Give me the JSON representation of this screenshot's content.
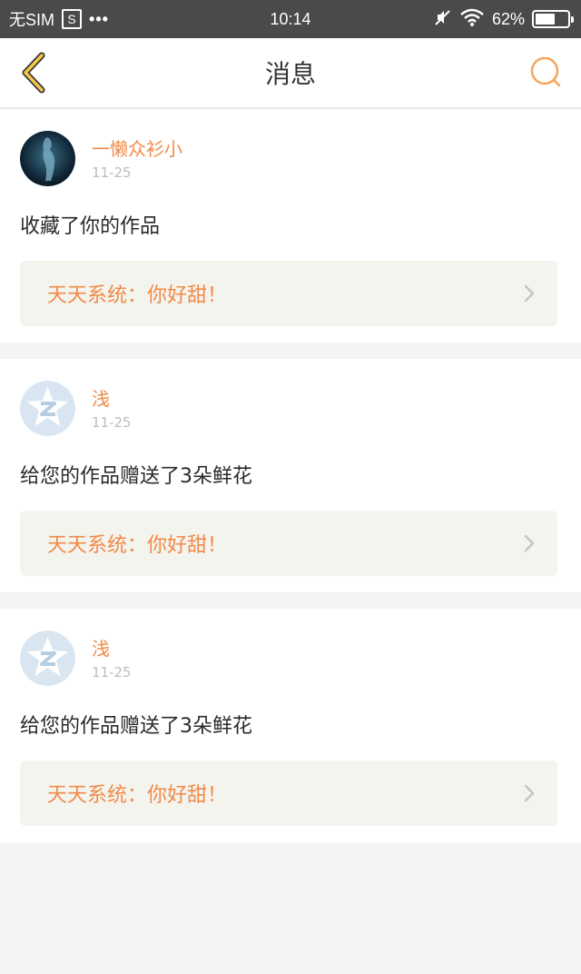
{
  "status_bar": {
    "carrier": "无SIM",
    "sim_icon_letter": "S",
    "dots": "•••",
    "time": "10:14",
    "battery": "62%",
    "battery_level": 0.62
  },
  "nav": {
    "title": "消息",
    "back_icon": "chevron-left-icon",
    "search_icon": "search-icon",
    "accent_color": "#f5a55c"
  },
  "messages": [
    {
      "user": "一懒众衫小",
      "date": "11-25",
      "text": "收藏了你的作品",
      "reference": "天天系统：你好甜！",
      "avatar": "photo-avatar"
    },
    {
      "user": "浅",
      "date": "11-25",
      "text": "给您的作品赠送了3朵鲜花",
      "reference": "天天系统：你好甜！",
      "avatar": "default-qq-avatar"
    },
    {
      "user": "浅",
      "date": "11-25",
      "text": "给您的作品赠送了3朵鲜花",
      "reference": "天天系统：你好甜！",
      "avatar": "default-qq-avatar"
    }
  ]
}
